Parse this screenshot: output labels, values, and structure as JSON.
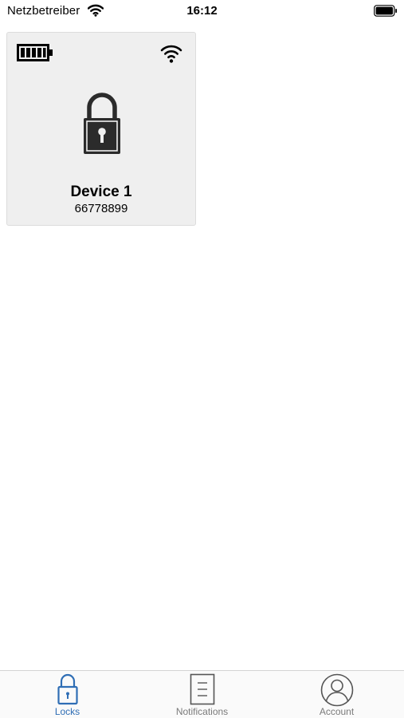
{
  "status_bar": {
    "carrier": "Netzbetreiber",
    "time": "16:12",
    "icons": [
      "wifi-icon",
      "battery-icon"
    ]
  },
  "devices": [
    {
      "name": "Device 1",
      "id": "66778899",
      "battery_level": 1.0,
      "icons": [
        "battery-full-icon",
        "wifi-icon",
        "padlock-locked-icon"
      ]
    }
  ],
  "tab_bar": {
    "active": "locks",
    "accent_color": "#2f6eb5",
    "inactive_color": "#7a7a7a",
    "tabs": [
      {
        "key": "locks",
        "label": "Locks",
        "icon": "padlock-icon"
      },
      {
        "key": "notifications",
        "label": "Notifications",
        "icon": "document-icon"
      },
      {
        "key": "account",
        "label": "Account",
        "icon": "user-icon"
      }
    ]
  }
}
